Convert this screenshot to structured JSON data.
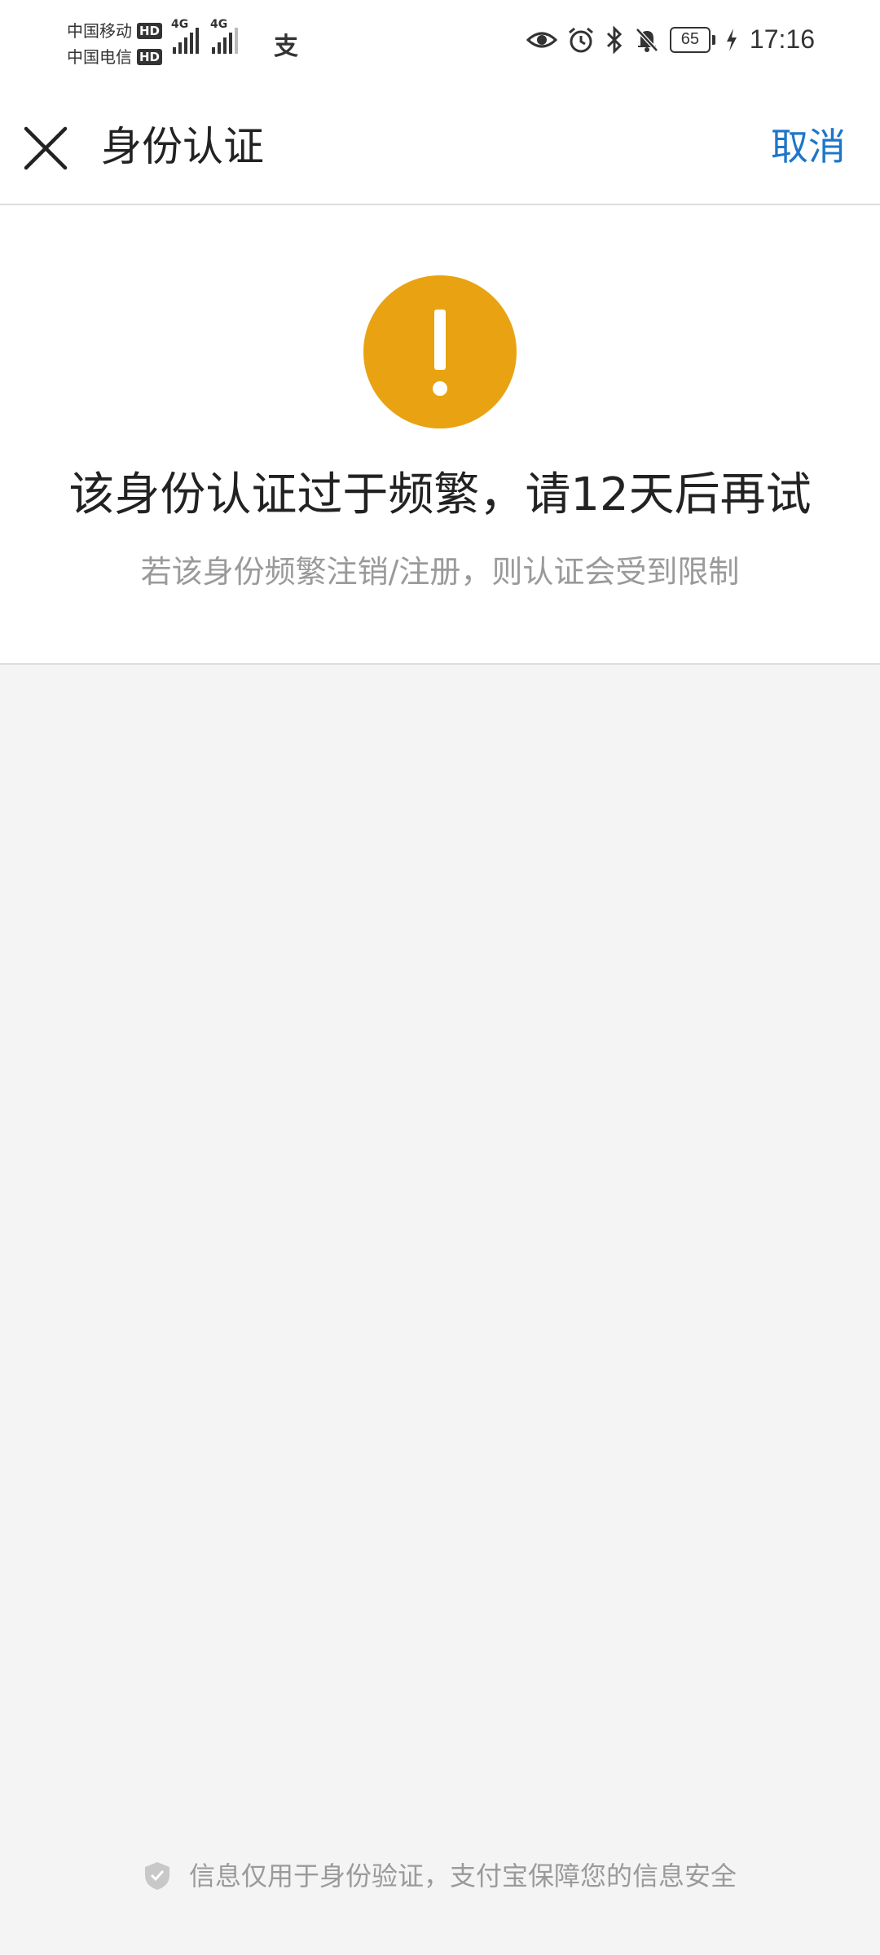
{
  "status_bar": {
    "carrier_1": "中国移动",
    "carrier_2": "中国电信",
    "hd_badge": "HD",
    "network_gen_1": "4G",
    "network_gen_2": "4G",
    "alipay_glyph": "支",
    "battery_level": "65",
    "time": "17:16",
    "icons": [
      "eye-icon",
      "alarm-icon",
      "bluetooth-icon",
      "bell-off-icon",
      "battery-icon",
      "charging-icon"
    ]
  },
  "nav": {
    "title": "身份认证",
    "cancel_label": "取消",
    "close_icon": "close-icon"
  },
  "result": {
    "icon": "warning-icon",
    "icon_color": "#e9a212",
    "title": "该身份认证过于频繁，请12天后再试",
    "subtitle": "若该身份频繁注销/注册，则认证会受到限制"
  },
  "footer": {
    "icon": "shield-icon",
    "text": "信息仅用于身份验证，支付宝保障您的信息安全"
  },
  "colors": {
    "accent": "#1e76c8",
    "warning": "#e9a212",
    "background": "#f4f4f4",
    "muted_text": "#9a9a9a"
  }
}
